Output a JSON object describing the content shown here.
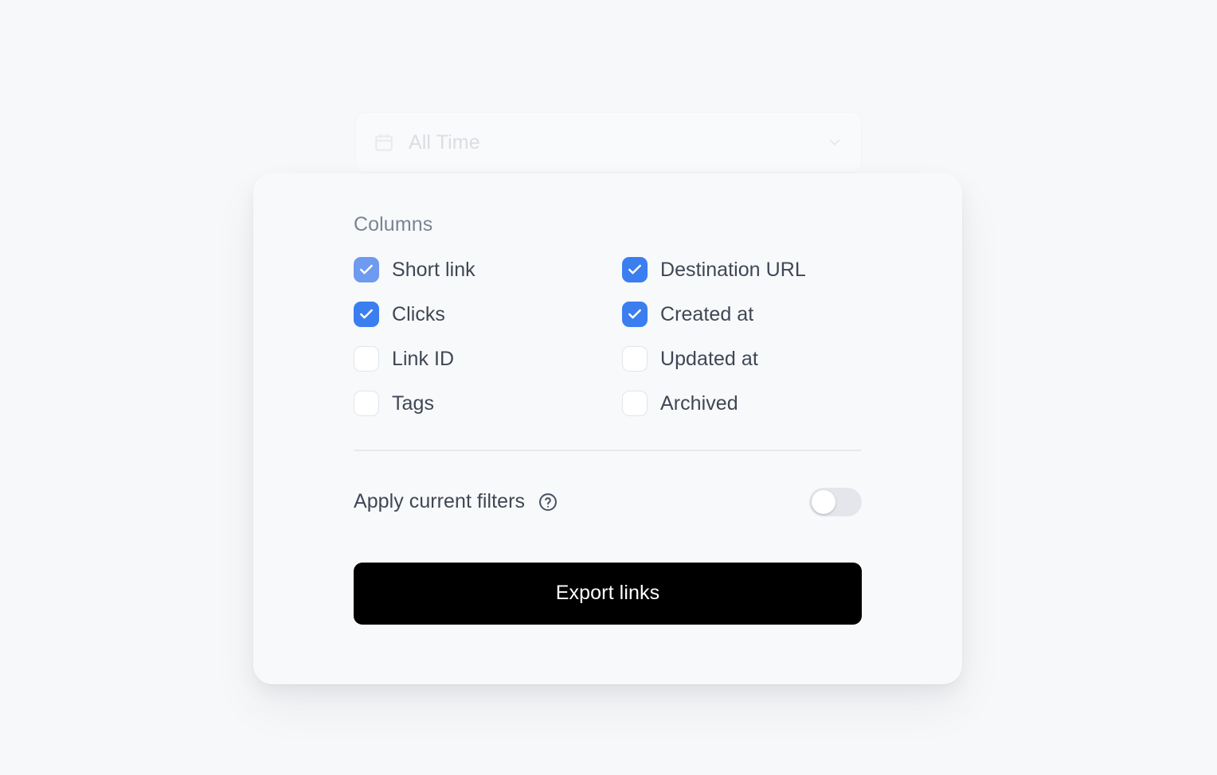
{
  "date_filter": {
    "icon": "calendar-icon",
    "value": "All Time",
    "chevron_icon": "chevron-down-icon"
  },
  "modal": {
    "columns_section": {
      "title": "Columns",
      "items": [
        {
          "label": "Short link",
          "checked": true,
          "state": "hover"
        },
        {
          "label": "Destination URL",
          "checked": true,
          "state": "normal"
        },
        {
          "label": "Clicks",
          "checked": true,
          "state": "normal"
        },
        {
          "label": "Created at",
          "checked": true,
          "state": "normal"
        },
        {
          "label": "Link ID",
          "checked": false,
          "state": "normal"
        },
        {
          "label": "Updated at",
          "checked": false,
          "state": "normal"
        },
        {
          "label": "Tags",
          "checked": false,
          "state": "normal"
        },
        {
          "label": "Archived",
          "checked": false,
          "state": "normal"
        }
      ]
    },
    "apply_filters": {
      "label": "Apply current filters",
      "help_icon": "help-circle-icon",
      "toggle_on": false
    },
    "export_button": {
      "label": "Export links"
    }
  },
  "colors": {
    "page_background": "#f7f8fa",
    "card_background": "#f8f9fb",
    "checkbox_checked": "#3b7ef0",
    "checkbox_checked_hover": "#6e9bf0",
    "checkbox_border": "#e2e5ea",
    "label_text": "#3f4754",
    "muted_text": "#7b8494",
    "divider": "#e6e8ec",
    "toggle_track_off": "#e4e6eb",
    "button_background": "#000000",
    "button_text": "#ffffff"
  }
}
